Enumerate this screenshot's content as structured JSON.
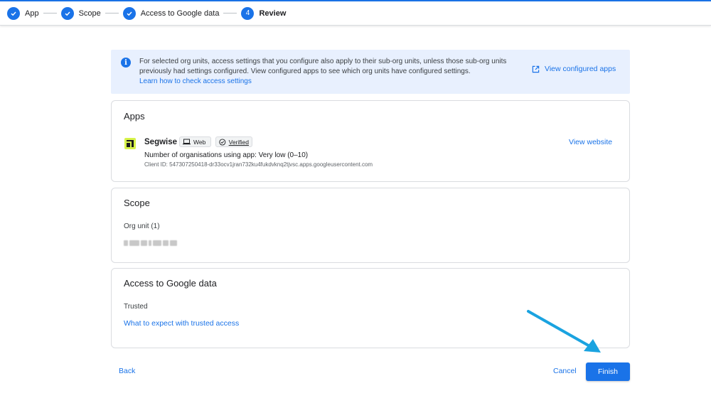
{
  "stepper": {
    "steps": [
      {
        "label": "App",
        "status": "done"
      },
      {
        "label": "Scope",
        "status": "done"
      },
      {
        "label": "Access to Google data",
        "status": "done"
      },
      {
        "label": "Review",
        "status": "current",
        "number": "4"
      }
    ]
  },
  "banner": {
    "text": "For selected org units, access settings that you configure also apply to their sub-org units, unless those sub-org units previously had settings configured. View configured apps to see which org units have configured settings.",
    "link": "Learn how to check access settings",
    "action": "View configured apps"
  },
  "apps": {
    "title": "Apps",
    "app_name": "Segwise",
    "platform_chip": "Web",
    "verified_chip": "Verified",
    "usage": "Number of organisations using app: Very low (0–10)",
    "client_id": "Client ID: 547307250418-dr33ocv1jran732ku4fukdvknq2tjvsc.apps.googleusercontent.com",
    "view_website": "View website"
  },
  "scope": {
    "title": "Scope",
    "org_unit_label": "Org unit (1)"
  },
  "access": {
    "title": "Access to Google data",
    "level": "Trusted",
    "link": "What to expect with trusted access"
  },
  "footer": {
    "back": "Back",
    "cancel": "Cancel",
    "finish": "Finish"
  },
  "colors": {
    "accent": "#1a73e8",
    "banner_bg": "#e8f0fe",
    "arrow": "#1aa3e0",
    "logo": "#d7f34a"
  }
}
